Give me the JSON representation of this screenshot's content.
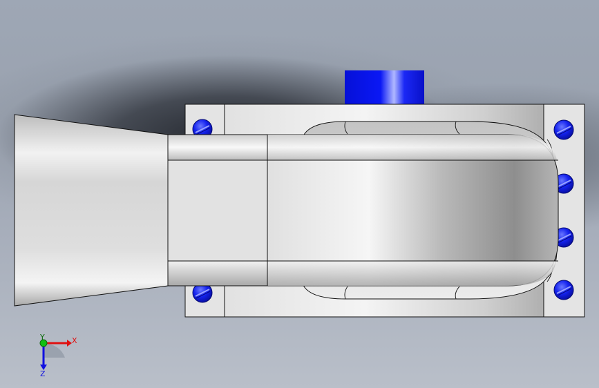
{
  "viewport": {
    "view": "Bottom",
    "background_top": "#9ea7b5",
    "background_bottom": "#b9bfc9"
  },
  "colors": {
    "screw_blue": "#0a14e6",
    "cap_blue": "#0b14f0",
    "body_gray": "#d9dadc",
    "plate_gray": "#e3e3e3",
    "edge": "#111111"
  },
  "triad": {
    "x_label": "X",
    "y_label": "Y",
    "z_label": "Z",
    "x_color": "#e01010",
    "y_color": "#10c010",
    "z_color": "#1010e0"
  },
  "icons": [
    "hex-screw-icon",
    "axis-triad-icon"
  ]
}
